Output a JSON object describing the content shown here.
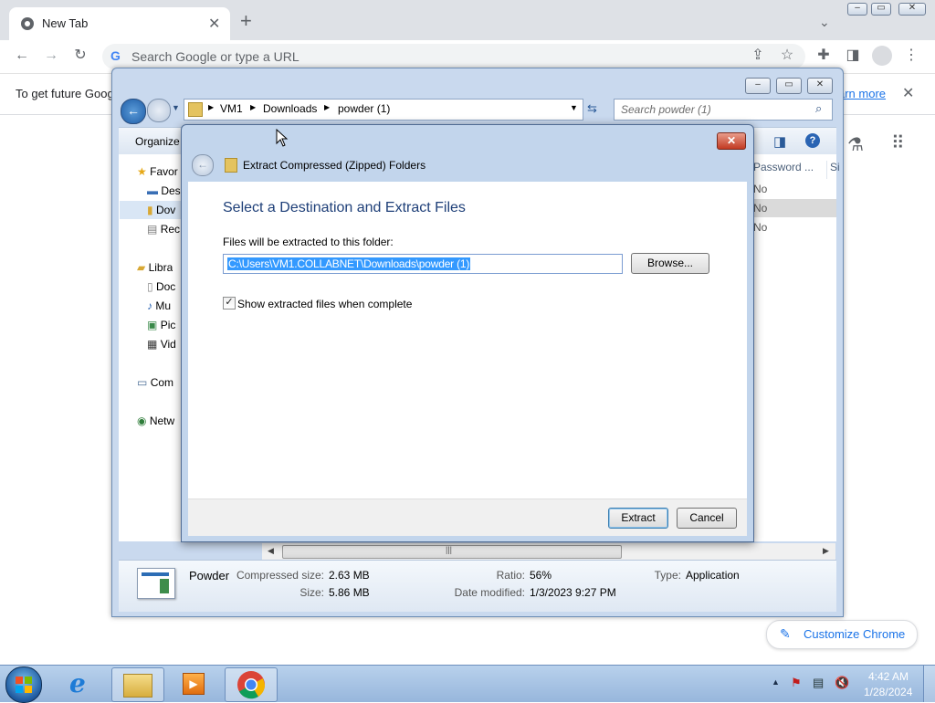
{
  "browser": {
    "tab_title": "New Tab",
    "omnibox_placeholder": "Search Google or type a URL",
    "infobar_text": "To get future Goog",
    "infobar_link": "arn more",
    "customize_label": "Customize Chrome"
  },
  "explorer": {
    "breadcrumb": [
      "VM1",
      "Downloads",
      "powder (1)"
    ],
    "search_placeholder": "Search powder (1)",
    "organize_label": "Organize",
    "nav": {
      "favorites": "Favor",
      "desktop": "Des",
      "downloads": "Dov",
      "recent": "Rec",
      "libraries": "Libra",
      "documents": "Doc",
      "music": "Mu",
      "pictures": "Pic",
      "videos": "Vid",
      "computer": "Com",
      "network": "Netw"
    },
    "columns": {
      "password": "Password ...",
      "size": "Si"
    },
    "rows": [
      "No",
      "No",
      "No"
    ],
    "details": {
      "name": "Powder",
      "compressed_label": "Compressed size:",
      "compressed_value": "2.63 MB",
      "size_label": "Size:",
      "size_value": "5.86 MB",
      "ratio_label": "Ratio:",
      "ratio_value": "56%",
      "modified_label": "Date modified:",
      "modified_value": "1/3/2023 9:27 PM",
      "type_label": "Type:",
      "type_value": "Application"
    }
  },
  "dialog": {
    "title": "Extract Compressed (Zipped) Folders",
    "heading": "Select a Destination and Extract Files",
    "folder_label": "Files will be extracted to this folder:",
    "path_value": "C:\\Users\\VM1.COLLABNET\\Downloads\\powder (1)",
    "browse_label": "Browse...",
    "checkbox_label": "Show extracted files when complete",
    "checkbox_checked": true,
    "extract_label": "Extract",
    "cancel_label": "Cancel"
  },
  "taskbar": {
    "time": "4:42 AM",
    "date": "1/28/2024"
  }
}
